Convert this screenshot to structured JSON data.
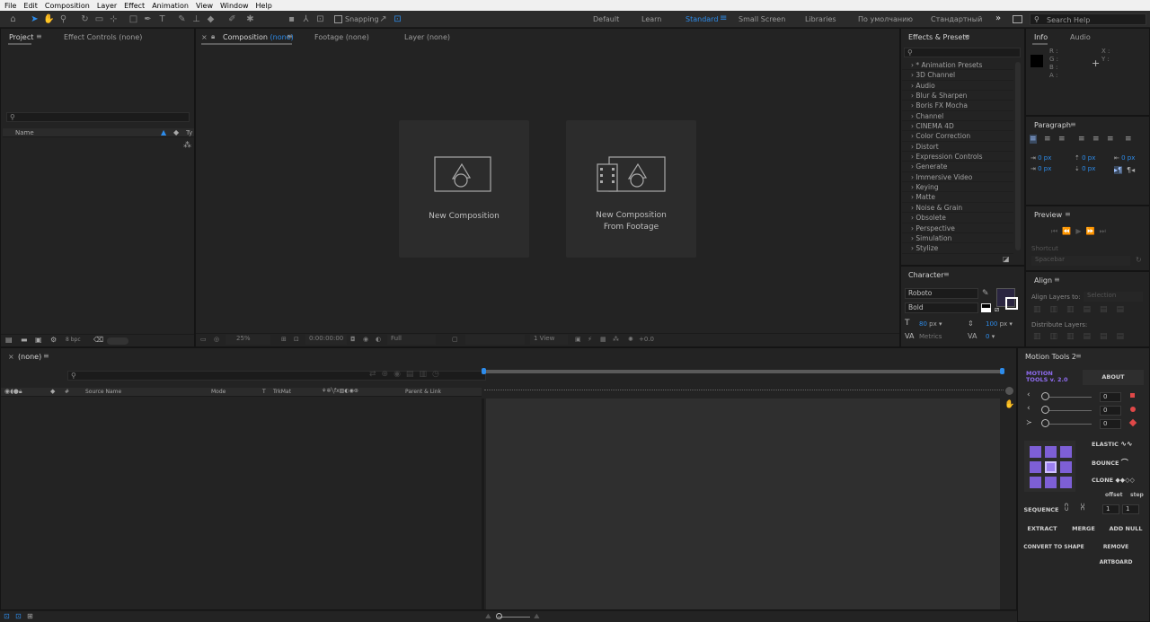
{
  "menu": [
    "File",
    "Edit",
    "Composition",
    "Layer",
    "Effect",
    "Animation",
    "View",
    "Window",
    "Help"
  ],
  "toolbar": {
    "snapping_label": "Snapping",
    "workspaces": [
      "Default",
      "Learn",
      "Standard",
      "Small Screen",
      "Libraries",
      "По умолчанию",
      "Стандартный"
    ],
    "active_workspace": "Standard",
    "more": "»",
    "search_placeholder": "Search Help"
  },
  "project": {
    "tabs": [
      "Project",
      "Effect Controls (none)"
    ],
    "col_name": "Name",
    "col_type": "Ty",
    "bpc": "8 bpc"
  },
  "comp": {
    "tab_prefix": "Composition",
    "tab_none": "(none)",
    "tabs": [
      "Footage (none)",
      "Layer (none)"
    ],
    "card1": "New Composition",
    "card2_line1": "New Composition",
    "card2_line2": "From Footage",
    "zoom": "25%",
    "time": "0:00:00:00",
    "res": "Full",
    "view": "1 View",
    "offset": "+0.0"
  },
  "effects": {
    "title": "Effects & Presets",
    "items": [
      "* Animation Presets",
      "3D Channel",
      "Audio",
      "Blur & Sharpen",
      "Boris FX Mocha",
      "Channel",
      "CINEMA 4D",
      "Color Correction",
      "Distort",
      "Expression Controls",
      "Generate",
      "Immersive Video",
      "Keying",
      "Matte",
      "Noise & Grain",
      "Obsolete",
      "Perspective",
      "Simulation",
      "Stylize"
    ]
  },
  "info": {
    "tabs": [
      "Info",
      "Audio"
    ],
    "rgb": [
      "R :",
      "G :",
      "B :",
      "A :"
    ],
    "xy": [
      "X :",
      "Y :"
    ]
  },
  "paragraph": {
    "title": "Paragraph",
    "px_values": [
      "0 px",
      "0 px",
      "0 px",
      "0 px",
      "0 px"
    ]
  },
  "preview": {
    "title": "Preview",
    "shortcut_label": "Shortcut",
    "shortcut_value": "Spacebar"
  },
  "character": {
    "title": "Character",
    "font": "Roboto",
    "style": "Bold",
    "size": "80",
    "size_unit": "px",
    "leading": "100",
    "leading_unit": "px",
    "kerning": "Metrics",
    "tracking": "0"
  },
  "align": {
    "title": "Align",
    "align_to_label": "Align Layers to:",
    "align_to_value": "Selection",
    "distribute_label": "Distribute Layers:"
  },
  "timeline": {
    "tab": "(none)",
    "headers": [
      "#",
      "Source Name",
      "Mode",
      "T",
      "TrkMat",
      "Parent & Link"
    ]
  },
  "motion_tools": {
    "title": "Motion Tools 2",
    "logo_line1": "MOTION",
    "logo_line2": "TOOLS v. 2.0",
    "about": "ABOUT",
    "values": [
      "0",
      "0",
      "0"
    ],
    "elastic": "ELASTIC",
    "bounce": "BOUNCE",
    "clone": "CLONE",
    "offset": "offset",
    "step": "step",
    "sequence": "SEQUENCE",
    "seq_values": [
      "1",
      "1"
    ],
    "extract": "EXTRACT",
    "merge": "MERGE",
    "add_null": "ADD NULL",
    "convert": "CONVERT TO SHAPE",
    "remove_artboard": "REMOVE ARTBOARD"
  },
  "colors": {
    "accent_blue": "#2d8ceb",
    "motion_purple": "#7d5fd6"
  }
}
